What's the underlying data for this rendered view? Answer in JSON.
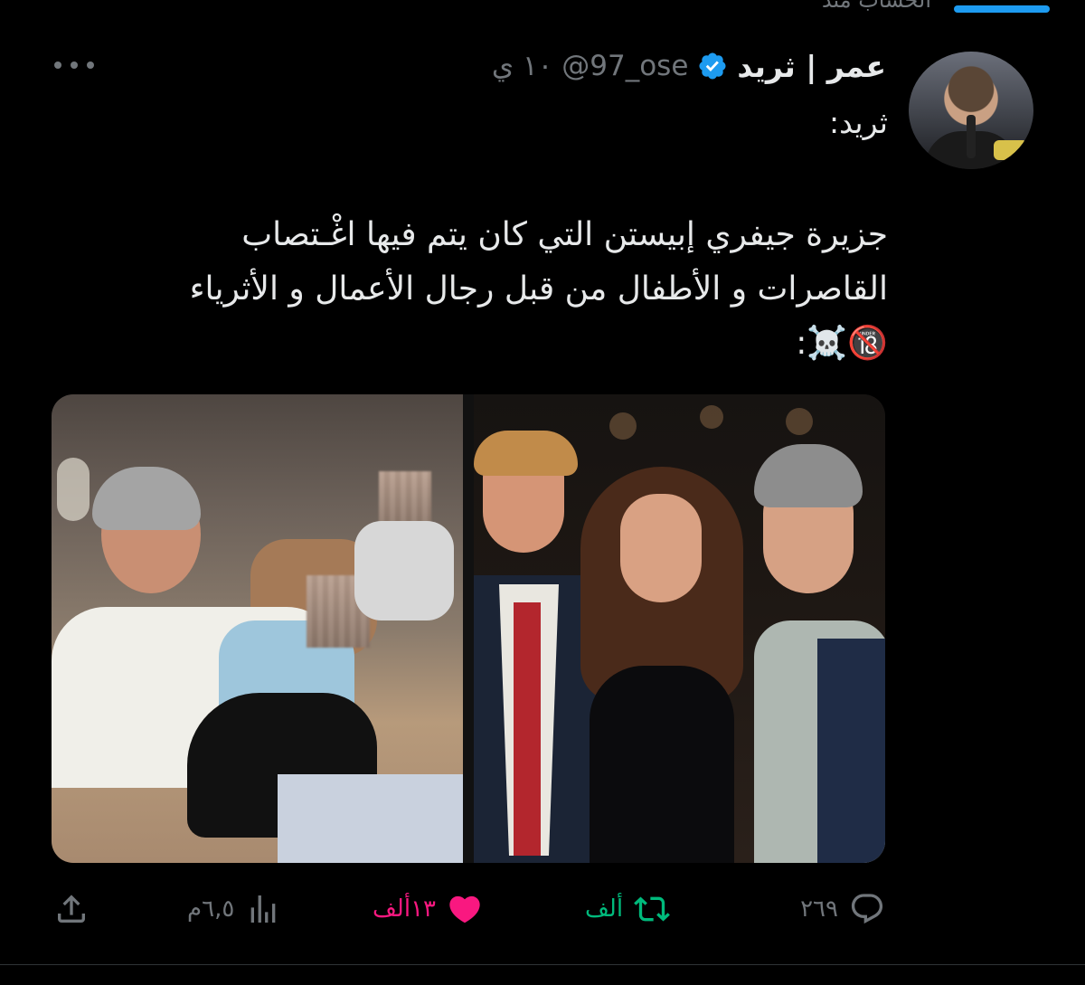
{
  "top_context": "الحساب منذ",
  "tweet": {
    "author_name": "عمر | ثريد",
    "handle": "@97_ose",
    "time": "١٠ ي",
    "quote_label": "ثريد:",
    "body_line1": "جزيرة جيفري إبيستن التي كان يتم فيها اغْـتصاب",
    "body_line2": "القاصرات و الأطفال من قبل رجال الأعمال و الأثرياء",
    "body_line3": "🔞☠️:",
    "stats": {
      "replies": "٢٦٩",
      "retweets": "ألف",
      "likes": "١٣ألف",
      "views": "٦,٥م"
    }
  },
  "colors": {
    "background": "#000000",
    "text": "#e7e9ea",
    "muted": "#71767b",
    "verified": "#1d9bf0",
    "retweet": "#00ba7c",
    "like": "#f91880"
  },
  "icons": {
    "verified": "verified-badge-icon",
    "more": "more-icon",
    "reply": "reply-icon",
    "retweet": "retweet-icon",
    "like": "heart-icon",
    "views": "views-icon",
    "share": "share-icon"
  }
}
